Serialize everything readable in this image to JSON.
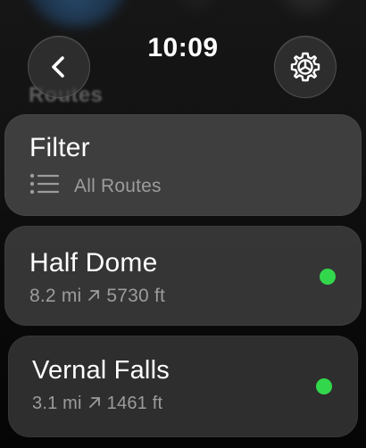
{
  "header": {
    "time": "10:09",
    "section_title": "Routes"
  },
  "icons": {
    "back": "chevron-left-icon",
    "settings": "gear-icon",
    "filter_list": "list-icon",
    "elevation": "arrow-up-right-icon"
  },
  "filter": {
    "label": "Filter",
    "value": "All Routes"
  },
  "routes": [
    {
      "name": "Half Dome",
      "distance": "8.2 mi",
      "elevation": "5730 ft",
      "status_color": "#32d74b"
    },
    {
      "name": "Vernal Falls",
      "distance": "3.1 mi",
      "elevation": "1461 ft",
      "status_color": "#32d74b"
    }
  ],
  "colors": {
    "status_green": "#32d74b"
  }
}
